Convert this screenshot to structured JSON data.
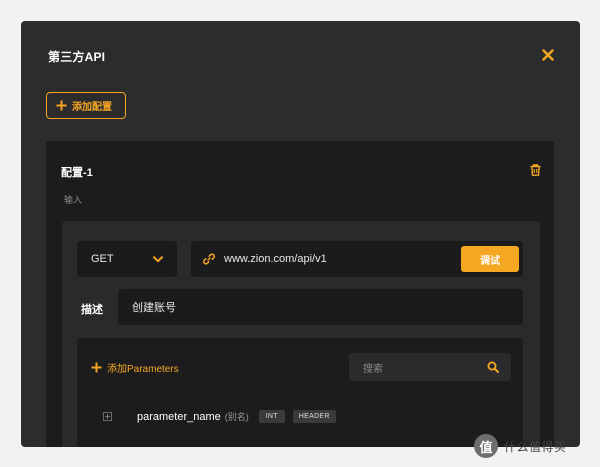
{
  "dialog": {
    "title": "第三方API",
    "add_config_label": "添加配置"
  },
  "config": {
    "title": "配置-1",
    "input_label": "输入",
    "method": "GET",
    "url": "www.zion.com/api/v1",
    "debug_label": "调试",
    "description_label": "描述",
    "description_value": "创建账号"
  },
  "parameters": {
    "add_label": "添加Parameters",
    "search_placeholder": "搜索",
    "rows": [
      {
        "name": "parameter_name",
        "alias": "(别名)",
        "type": "INT",
        "location": "HEADER"
      }
    ]
  },
  "watermark": {
    "badge": "值",
    "text": "什么值得买"
  },
  "colors": {
    "accent": "#f5a623",
    "dialog_bg": "#2c2c2d",
    "card_bg": "#1c1c1e"
  },
  "icons": {
    "close": "close-icon",
    "add": "plus-icon",
    "delete": "trash-icon",
    "dropdown": "chevron-down-icon",
    "link": "link-icon",
    "search": "search-icon",
    "expand": "expand-square-icon"
  }
}
